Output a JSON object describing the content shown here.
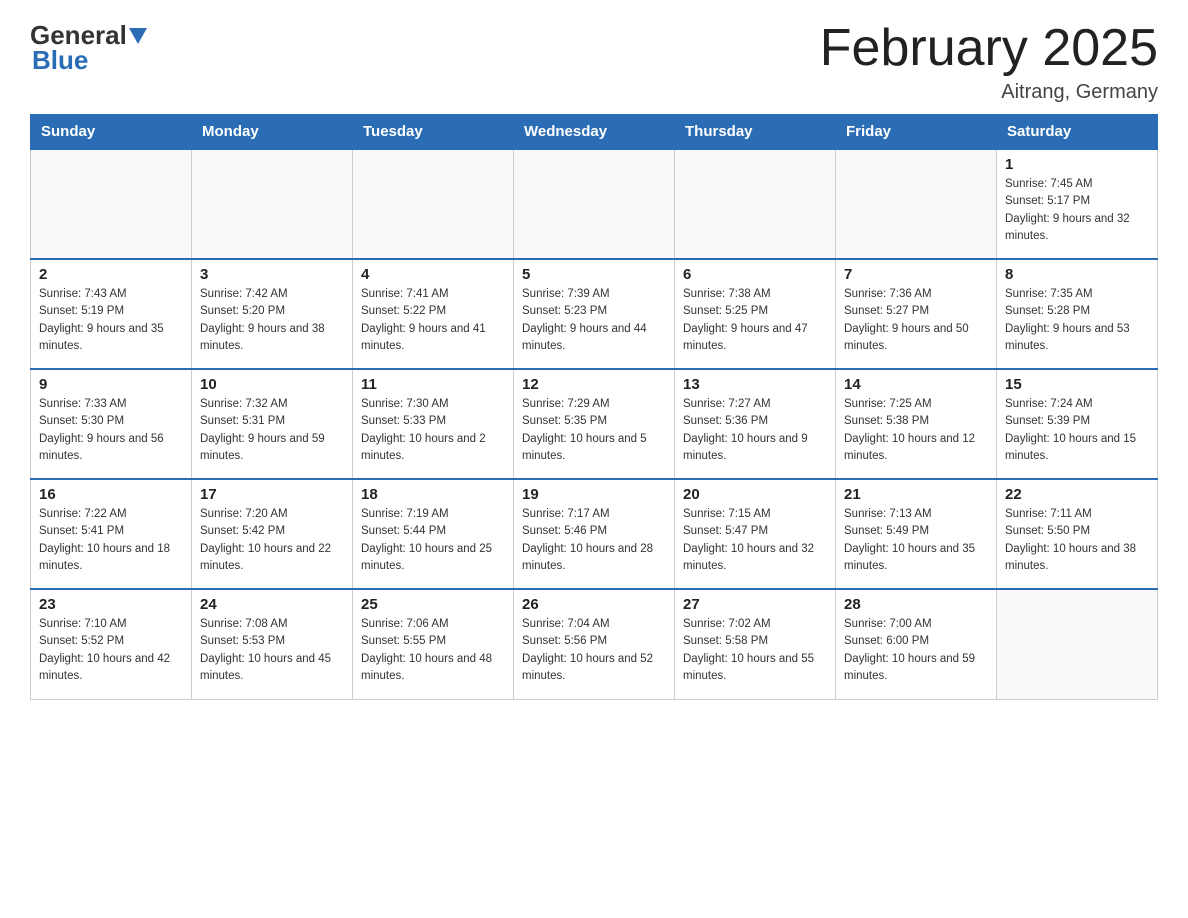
{
  "header": {
    "logo_general": "General",
    "logo_blue": "Blue",
    "title": "February 2025",
    "location": "Aitrang, Germany"
  },
  "days_of_week": [
    "Sunday",
    "Monday",
    "Tuesday",
    "Wednesday",
    "Thursday",
    "Friday",
    "Saturday"
  ],
  "weeks": [
    [
      {
        "day": "",
        "info": ""
      },
      {
        "day": "",
        "info": ""
      },
      {
        "day": "",
        "info": ""
      },
      {
        "day": "",
        "info": ""
      },
      {
        "day": "",
        "info": ""
      },
      {
        "day": "",
        "info": ""
      },
      {
        "day": "1",
        "info": "Sunrise: 7:45 AM\nSunset: 5:17 PM\nDaylight: 9 hours and 32 minutes."
      }
    ],
    [
      {
        "day": "2",
        "info": "Sunrise: 7:43 AM\nSunset: 5:19 PM\nDaylight: 9 hours and 35 minutes."
      },
      {
        "day": "3",
        "info": "Sunrise: 7:42 AM\nSunset: 5:20 PM\nDaylight: 9 hours and 38 minutes."
      },
      {
        "day": "4",
        "info": "Sunrise: 7:41 AM\nSunset: 5:22 PM\nDaylight: 9 hours and 41 minutes."
      },
      {
        "day": "5",
        "info": "Sunrise: 7:39 AM\nSunset: 5:23 PM\nDaylight: 9 hours and 44 minutes."
      },
      {
        "day": "6",
        "info": "Sunrise: 7:38 AM\nSunset: 5:25 PM\nDaylight: 9 hours and 47 minutes."
      },
      {
        "day": "7",
        "info": "Sunrise: 7:36 AM\nSunset: 5:27 PM\nDaylight: 9 hours and 50 minutes."
      },
      {
        "day": "8",
        "info": "Sunrise: 7:35 AM\nSunset: 5:28 PM\nDaylight: 9 hours and 53 minutes."
      }
    ],
    [
      {
        "day": "9",
        "info": "Sunrise: 7:33 AM\nSunset: 5:30 PM\nDaylight: 9 hours and 56 minutes."
      },
      {
        "day": "10",
        "info": "Sunrise: 7:32 AM\nSunset: 5:31 PM\nDaylight: 9 hours and 59 minutes."
      },
      {
        "day": "11",
        "info": "Sunrise: 7:30 AM\nSunset: 5:33 PM\nDaylight: 10 hours and 2 minutes."
      },
      {
        "day": "12",
        "info": "Sunrise: 7:29 AM\nSunset: 5:35 PM\nDaylight: 10 hours and 5 minutes."
      },
      {
        "day": "13",
        "info": "Sunrise: 7:27 AM\nSunset: 5:36 PM\nDaylight: 10 hours and 9 minutes."
      },
      {
        "day": "14",
        "info": "Sunrise: 7:25 AM\nSunset: 5:38 PM\nDaylight: 10 hours and 12 minutes."
      },
      {
        "day": "15",
        "info": "Sunrise: 7:24 AM\nSunset: 5:39 PM\nDaylight: 10 hours and 15 minutes."
      }
    ],
    [
      {
        "day": "16",
        "info": "Sunrise: 7:22 AM\nSunset: 5:41 PM\nDaylight: 10 hours and 18 minutes."
      },
      {
        "day": "17",
        "info": "Sunrise: 7:20 AM\nSunset: 5:42 PM\nDaylight: 10 hours and 22 minutes."
      },
      {
        "day": "18",
        "info": "Sunrise: 7:19 AM\nSunset: 5:44 PM\nDaylight: 10 hours and 25 minutes."
      },
      {
        "day": "19",
        "info": "Sunrise: 7:17 AM\nSunset: 5:46 PM\nDaylight: 10 hours and 28 minutes."
      },
      {
        "day": "20",
        "info": "Sunrise: 7:15 AM\nSunset: 5:47 PM\nDaylight: 10 hours and 32 minutes."
      },
      {
        "day": "21",
        "info": "Sunrise: 7:13 AM\nSunset: 5:49 PM\nDaylight: 10 hours and 35 minutes."
      },
      {
        "day": "22",
        "info": "Sunrise: 7:11 AM\nSunset: 5:50 PM\nDaylight: 10 hours and 38 minutes."
      }
    ],
    [
      {
        "day": "23",
        "info": "Sunrise: 7:10 AM\nSunset: 5:52 PM\nDaylight: 10 hours and 42 minutes."
      },
      {
        "day": "24",
        "info": "Sunrise: 7:08 AM\nSunset: 5:53 PM\nDaylight: 10 hours and 45 minutes."
      },
      {
        "day": "25",
        "info": "Sunrise: 7:06 AM\nSunset: 5:55 PM\nDaylight: 10 hours and 48 minutes."
      },
      {
        "day": "26",
        "info": "Sunrise: 7:04 AM\nSunset: 5:56 PM\nDaylight: 10 hours and 52 minutes."
      },
      {
        "day": "27",
        "info": "Sunrise: 7:02 AM\nSunset: 5:58 PM\nDaylight: 10 hours and 55 minutes."
      },
      {
        "day": "28",
        "info": "Sunrise: 7:00 AM\nSunset: 6:00 PM\nDaylight: 10 hours and 59 minutes."
      },
      {
        "day": "",
        "info": ""
      }
    ]
  ]
}
